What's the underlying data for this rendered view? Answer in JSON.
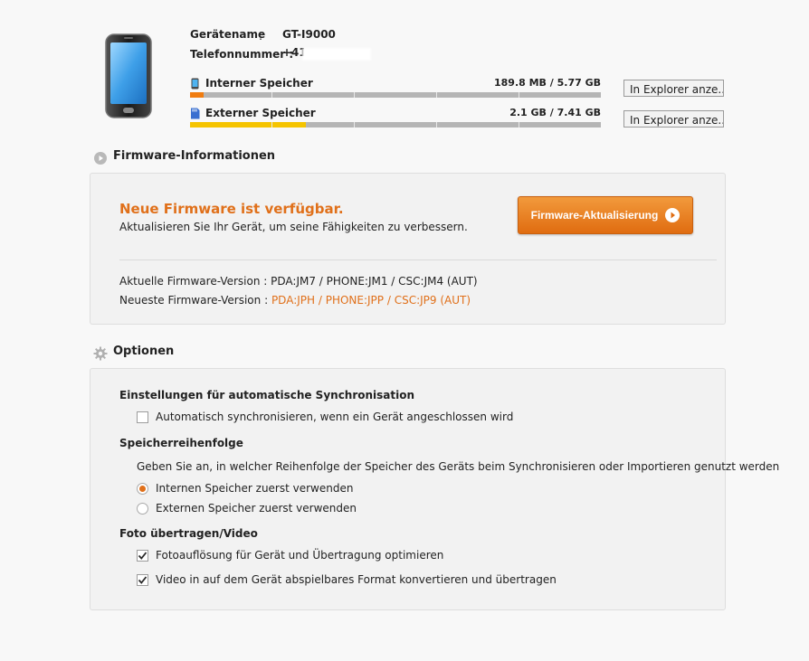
{
  "device": {
    "name_label": "Gerätename",
    "name_colon": ":",
    "name_value": "GT-I9000",
    "phone_label": "Telefonnummer :",
    "phone_value": "+41"
  },
  "storage": [
    {
      "title": "Interner Speicher",
      "usage": "189.8 MB / 5.77 GB",
      "fill_fraction": 0.032,
      "fill_color": "#f07c10",
      "icon": "phone-memory-icon",
      "button": "In Explorer anze..."
    },
    {
      "title": "Externer Speicher",
      "usage": "2.1 GB / 7.41 GB",
      "fill_fraction": 0.283,
      "fill_color": "#f5c400",
      "icon": "sd-card-icon",
      "button": "In Explorer anze..."
    }
  ],
  "firmware": {
    "section_title": "Firmware-Informationen",
    "headline": "Neue Firmware ist verfügbar.",
    "subtitle": "Aktualisieren Sie Ihr Gerät, um seine Fähigkeiten zu verbessern.",
    "update_button": "Firmware-Aktualisierung",
    "current_label": "Aktuelle Firmware-Version : ",
    "current_value": "PDA:JM7 / PHONE:JM1 / CSC:JM4 (AUT)",
    "latest_label": "Neueste Firmware-Version : ",
    "latest_value": "PDA:JPH / PHONE:JPP / CSC:JP9 (AUT)"
  },
  "options": {
    "section_title": "Optionen",
    "sync_heading": "Einstellungen für automatische Synchronisation",
    "sync_checkbox": {
      "label": "Automatisch synchronisieren, wenn ein Gerät angeschlossen wird",
      "checked": false
    },
    "storage_heading": "Speicherreihenfolge",
    "storage_desc": "Geben Sie an, in welcher Reihenfolge der Speicher des Geräts beim Synchronisieren oder Importieren genutzt werden",
    "radio_internal": {
      "label": "Internen Speicher zuerst verwenden",
      "selected": true
    },
    "radio_external": {
      "label": "Externen Speicher zuerst verwenden",
      "selected": false
    },
    "photo_heading": "Foto übertragen/Video",
    "photo_checkbox": {
      "label": "Fotoauflösung für Gerät und Übertragung optimieren",
      "checked": true
    },
    "video_checkbox": {
      "label": "Video in auf dem Gerät abspielbares Format konvertieren und übertragen",
      "checked": true
    }
  },
  "colors": {
    "accent": "#e0701a",
    "panel_bg": "#f2f2f2"
  }
}
